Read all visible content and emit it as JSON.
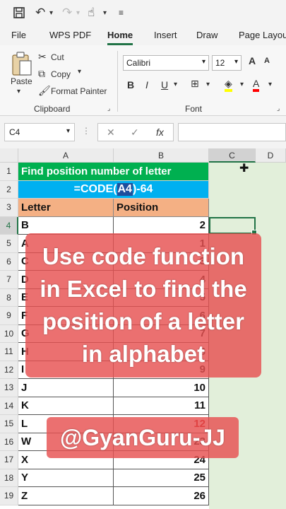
{
  "qat": {
    "save_icon": "save-icon",
    "undo_icon": "undo-icon",
    "redo_icon": "redo-icon",
    "touch_icon": "touch-mode-icon",
    "customize_icon": "customize-icon"
  },
  "tabs": [
    {
      "label": "File"
    },
    {
      "label": "WPS PDF"
    },
    {
      "label": "Home"
    },
    {
      "label": "Insert"
    },
    {
      "label": "Draw"
    },
    {
      "label": "Page Layou"
    }
  ],
  "ribbon": {
    "paste_label": "Paste",
    "cut_label": "Cut",
    "copy_label": "Copy",
    "format_painter_label": "Format Painter",
    "clipboard_group": "Clipboard",
    "font_name": "Calibri",
    "font_size": "12",
    "font_group": "Font",
    "bold": "B",
    "italic": "I",
    "underline": "U",
    "font_color_letter": "A"
  },
  "formula_bar": {
    "name_box": "C4",
    "cancel": "✕",
    "enter": "✓",
    "fx": "fx",
    "value": ""
  },
  "sheet": {
    "columns": [
      "A",
      "B",
      "C",
      "D"
    ],
    "rows": [
      "1",
      "2",
      "3",
      "4",
      "5",
      "6",
      "7",
      "8",
      "9",
      "10",
      "11",
      "12",
      "13",
      "14",
      "15",
      "16",
      "17",
      "18",
      "19"
    ],
    "title": "Find position number of letter",
    "formula_prefix": "=CODE(",
    "formula_ref": "A4",
    "formula_suffix": ")-64",
    "header_letter": "Letter",
    "header_position": "Position",
    "data": [
      {
        "letter": "B",
        "position": "2"
      },
      {
        "letter": "A",
        "position": "1"
      },
      {
        "letter": "C",
        "position": "3"
      },
      {
        "letter": "D",
        "position": "4"
      },
      {
        "letter": "E",
        "position": "5"
      },
      {
        "letter": "F",
        "position": "6"
      },
      {
        "letter": "G",
        "position": "7"
      },
      {
        "letter": "H",
        "position": "8"
      },
      {
        "letter": "I",
        "position": "9"
      },
      {
        "letter": "J",
        "position": "10"
      },
      {
        "letter": "K",
        "position": "11"
      },
      {
        "letter": "L",
        "position": "12"
      },
      {
        "letter": "W",
        "position": "23"
      },
      {
        "letter": "X",
        "position": "24"
      },
      {
        "letter": "Y",
        "position": "25"
      },
      {
        "letter": "Z",
        "position": "26"
      }
    ]
  },
  "overlay": {
    "caption": "Use code function in Excel to find the position of a letter in alphabet",
    "handle": "@GyanGuru-JJ"
  },
  "colors": {
    "title_bg": "#00b050",
    "formula_bg": "#00b0f0",
    "header_bg": "#f4b084",
    "accent": "#217346",
    "overlay": "#e65050"
  }
}
